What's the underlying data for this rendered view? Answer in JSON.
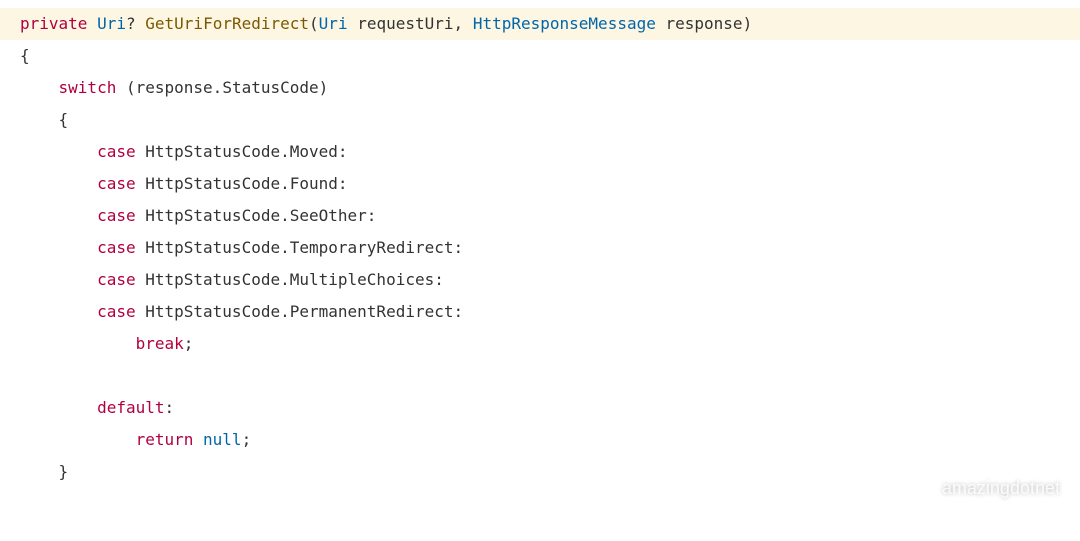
{
  "code": {
    "line1": {
      "private": "private",
      "uri": "Uri",
      "q": "?",
      "sp1": " ",
      "method": "GetUriForRedirect",
      "lp": "(",
      "p1type": "Uri",
      "sp2": " ",
      "p1name": "requestUri",
      "comma": ",",
      "sp3": " ",
      "p2type": "HttpResponseMessage",
      "sp4": " ",
      "p2name": "response",
      "rp": ")"
    },
    "line2": "{",
    "line3": {
      "switch": "switch",
      "sp": " ",
      "lp": "(",
      "resp": "response",
      "dot": ".",
      "sc": "StatusCode",
      "rp": ")"
    },
    "line4": "{",
    "cases": [
      {
        "case": "case",
        "sp": " ",
        "type": "HttpStatusCode",
        "dot": ".",
        "member": "Moved",
        "colon": ":"
      },
      {
        "case": "case",
        "sp": " ",
        "type": "HttpStatusCode",
        "dot": ".",
        "member": "Found",
        "colon": ":"
      },
      {
        "case": "case",
        "sp": " ",
        "type": "HttpStatusCode",
        "dot": ".",
        "member": "SeeOther",
        "colon": ":"
      },
      {
        "case": "case",
        "sp": " ",
        "type": "HttpStatusCode",
        "dot": ".",
        "member": "TemporaryRedirect",
        "colon": ":"
      },
      {
        "case": "case",
        "sp": " ",
        "type": "HttpStatusCode",
        "dot": ".",
        "member": "MultipleChoices",
        "colon": ":"
      },
      {
        "case": "case",
        "sp": " ",
        "type": "HttpStatusCode",
        "dot": ".",
        "member": "PermanentRedirect",
        "colon": ":"
      }
    ],
    "break": {
      "break": "break",
      "semi": ";"
    },
    "default": {
      "default": "default",
      "colon": ":"
    },
    "return": {
      "return": "return",
      "sp": " ",
      "null": "null",
      "semi": ";"
    },
    "closebrace": "}"
  },
  "watermark": {
    "text": "amazingdotnet"
  }
}
